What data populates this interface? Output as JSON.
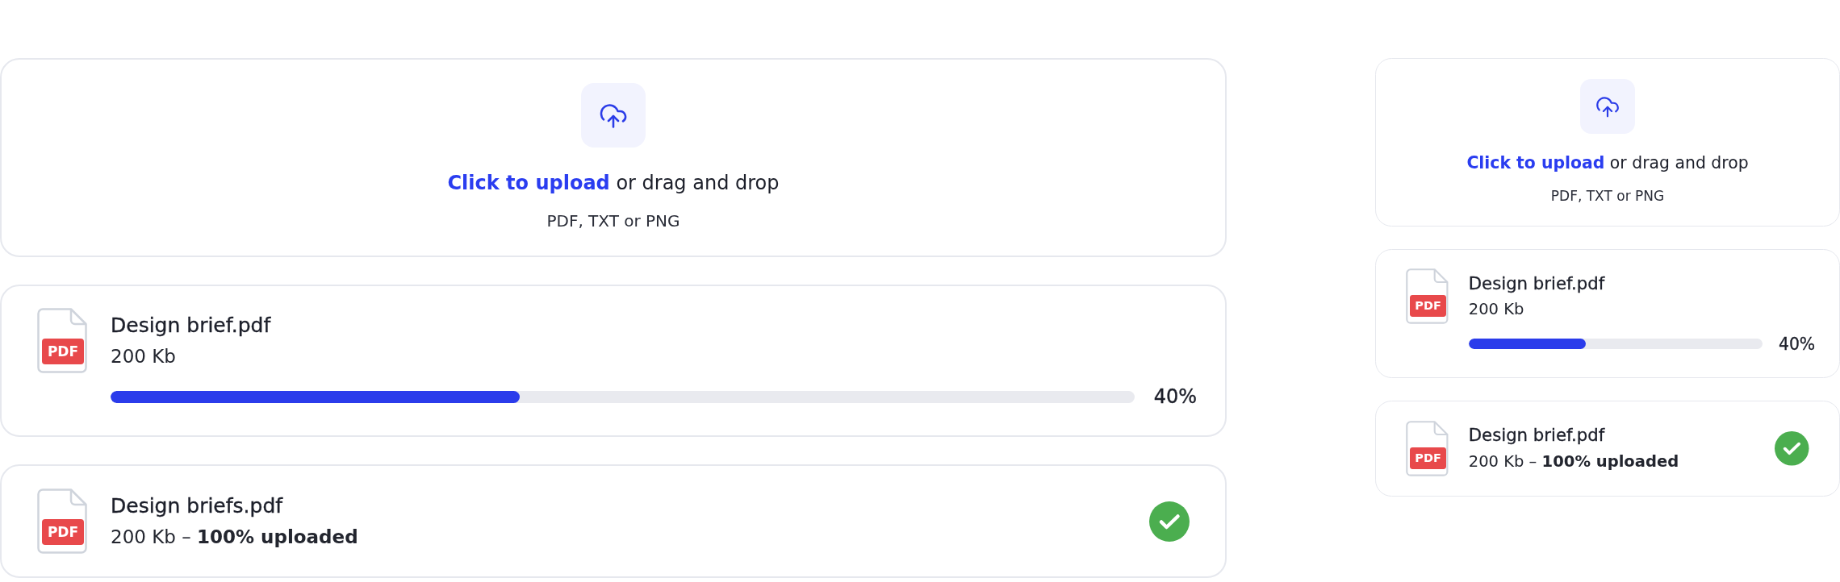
{
  "panels": [
    {
      "upload": {
        "link": "Click to upload",
        "text": "or drag and drop",
        "hint": "PDF, TXT or PNG"
      },
      "files": [
        {
          "kind": "progress",
          "type_label": "PDF",
          "name": "Design brief.pdf",
          "detail": "200 Kb",
          "level": 0.4,
          "reading": "40%"
        },
        {
          "kind": "complete",
          "type_label": "PDF",
          "name": "Design briefs.pdf",
          "detail": "200 Kb – **100% uploaded**"
        }
      ]
    },
    {
      "upload": {
        "link": "Click to upload",
        "text": "or drag and drop",
        "hint": "PDF, TXT or PNG"
      },
      "files": [
        {
          "kind": "progress",
          "type_label": "PDF",
          "name": "Design brief.pdf",
          "detail": "200 Kb",
          "level": 0.4,
          "reading": "40%"
        },
        {
          "kind": "complete",
          "type_label": "PDF",
          "name": "Design brief.pdf",
          "detail": "200 Kb – **100% uploaded**"
        }
      ]
    }
  ]
}
